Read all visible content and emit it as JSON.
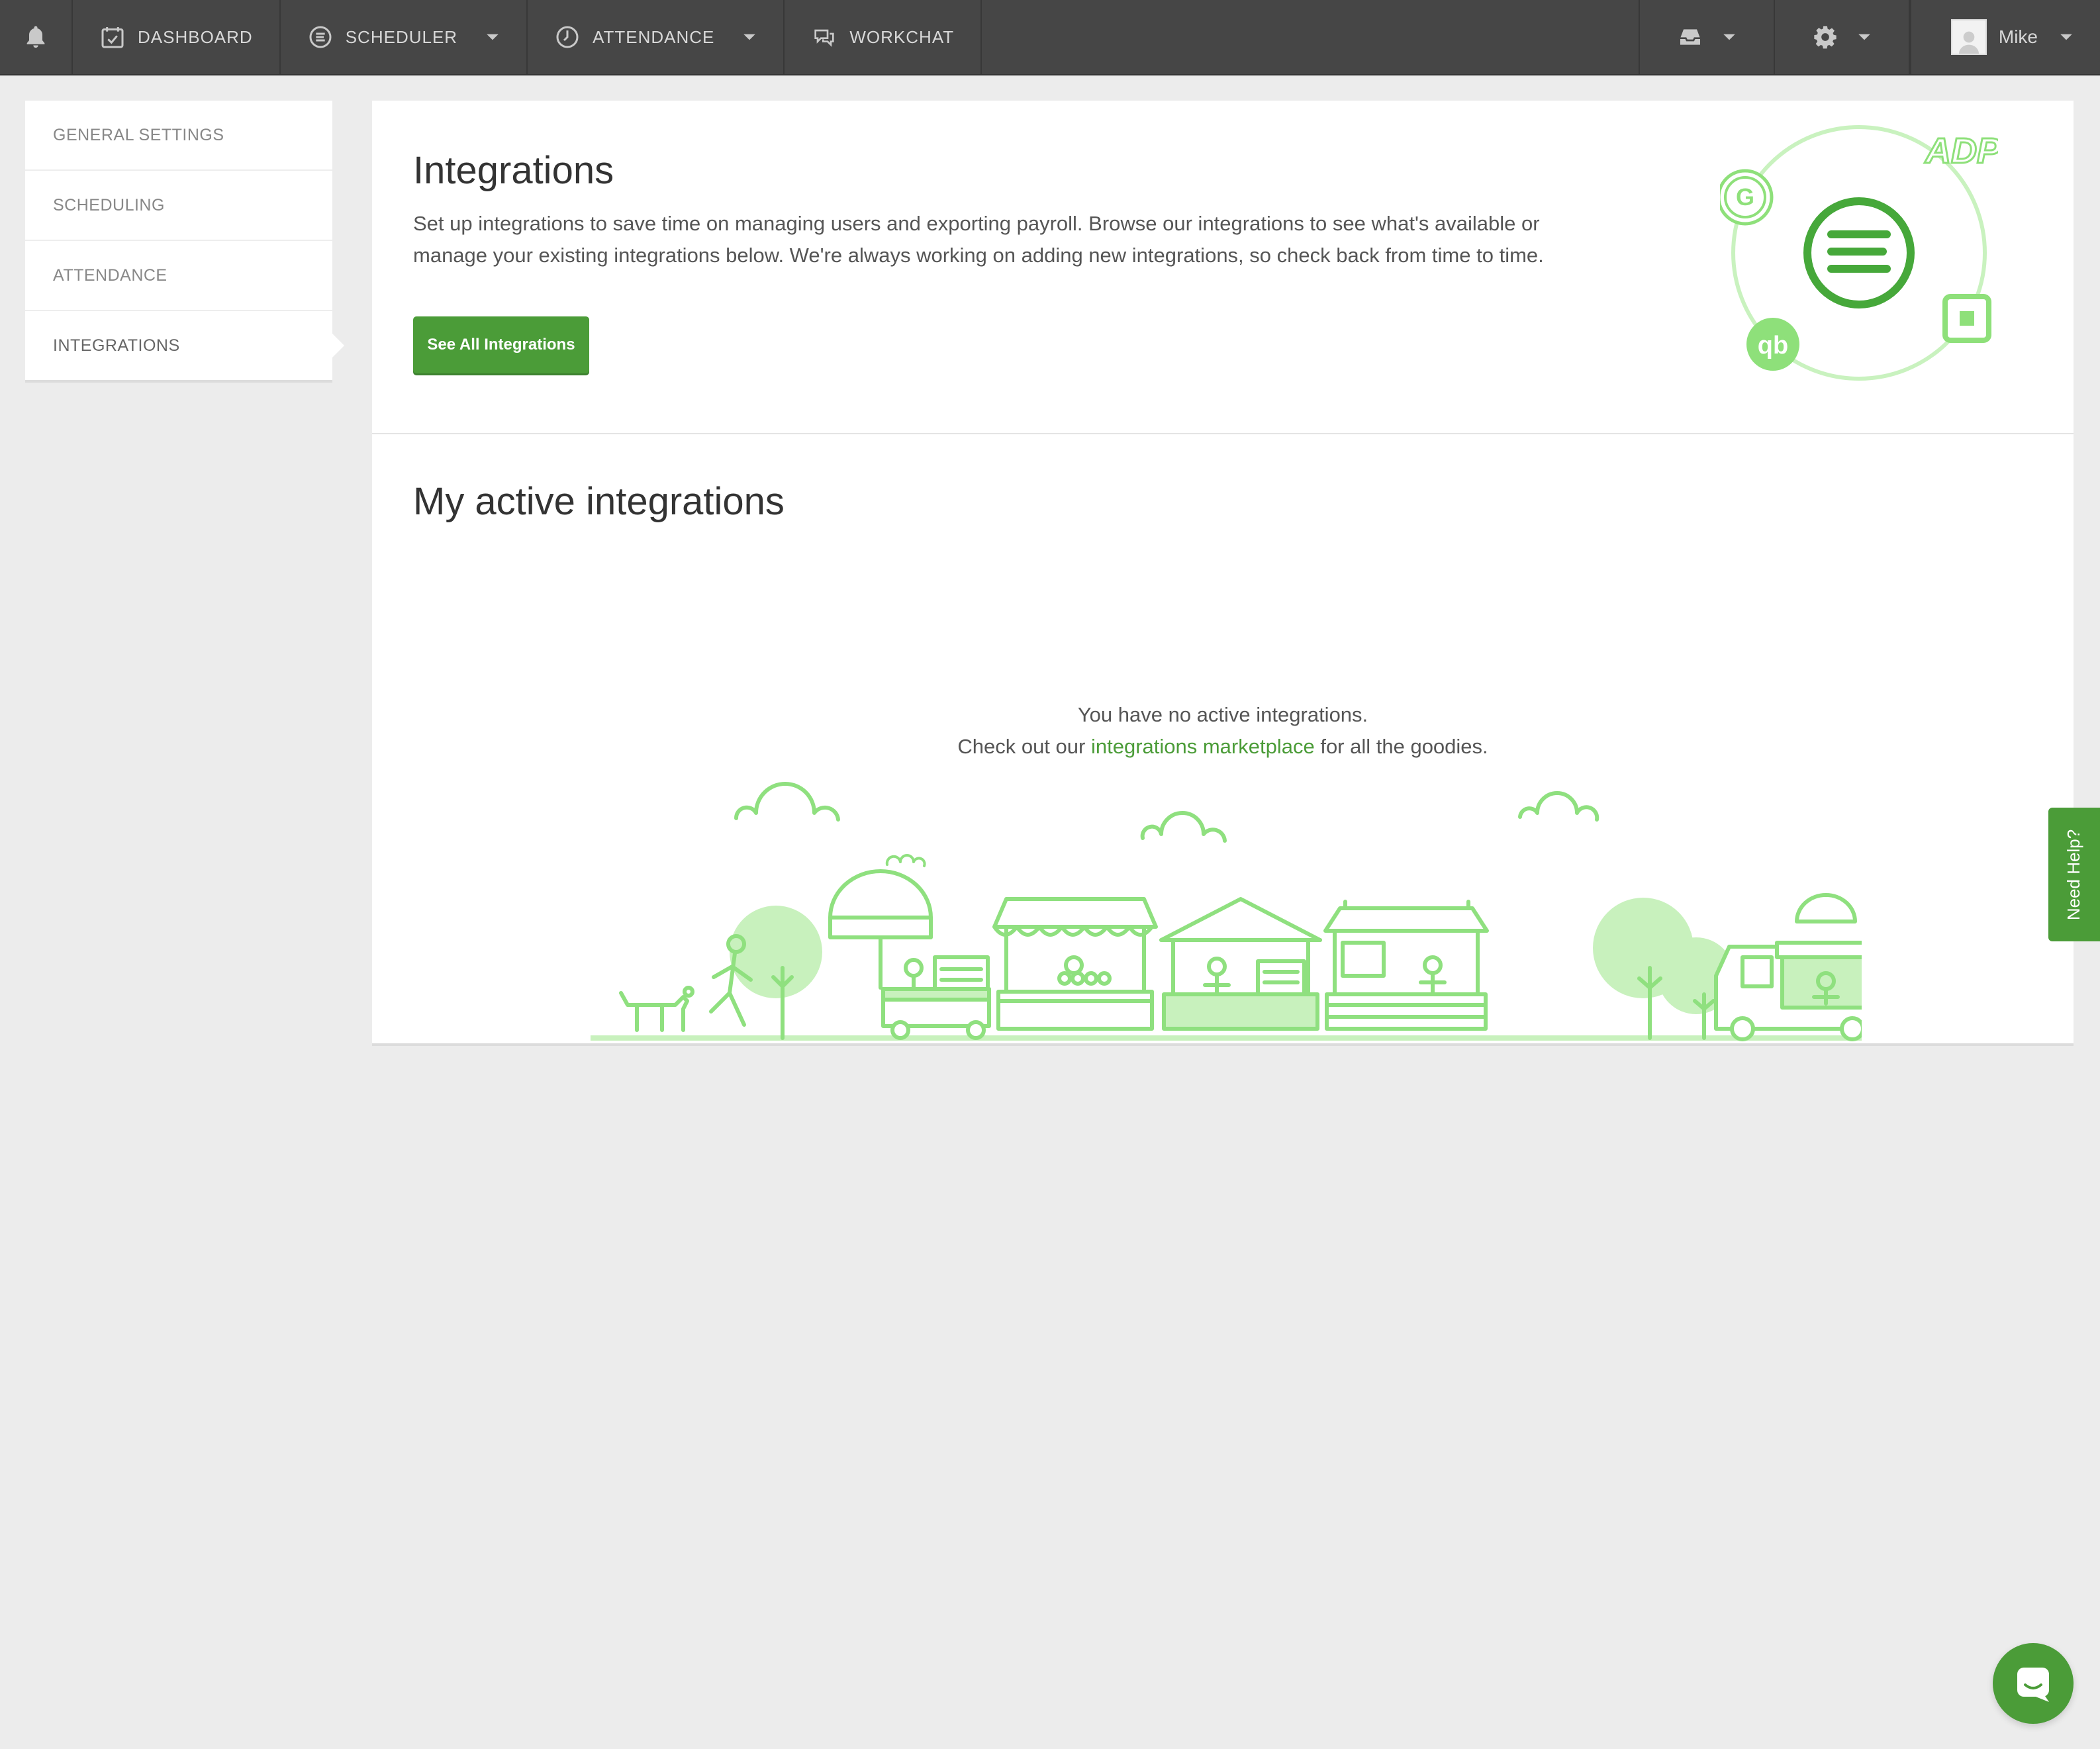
{
  "nav": {
    "dashboard": "DASHBOARD",
    "scheduler": "SCHEDULER",
    "attendance": "ATTENDANCE",
    "workchat": "WORKCHAT",
    "user_name": "Mike"
  },
  "sidebar": {
    "items": [
      {
        "label": "GENERAL SETTINGS"
      },
      {
        "label": "SCHEDULING"
      },
      {
        "label": "ATTENDANCE"
      },
      {
        "label": "INTEGRATIONS"
      }
    ],
    "active_index": 3
  },
  "integrations": {
    "title": "Integrations",
    "description": "Set up integrations to save time on managing users and exporting payroll. Browse our integrations to see what's available or manage your existing integrations below. We're always working on adding new integrations, so check back from time to time.",
    "button_label": "See All Integrations",
    "graphic_labels": [
      "ADP",
      "G",
      "qb"
    ]
  },
  "active": {
    "title": "My active integrations",
    "empty_line1": "You have no active integrations.",
    "empty_line2_prefix": "Check out our",
    "empty_link": "integrations marketplace",
    "empty_line2_suffix": "for all the goodies."
  },
  "help_tab": "Need Help?",
  "colors": {
    "brand_green": "#4b9c38",
    "illustration_green": "#8fe07f",
    "nav_bg": "#464646"
  },
  "icons": [
    "bell-icon",
    "calendar-icon",
    "scheduler-icon",
    "clock-icon",
    "chat-icon",
    "inbox-icon",
    "gear-icon",
    "chevron-down-icon",
    "chat-bubble-icon"
  ]
}
